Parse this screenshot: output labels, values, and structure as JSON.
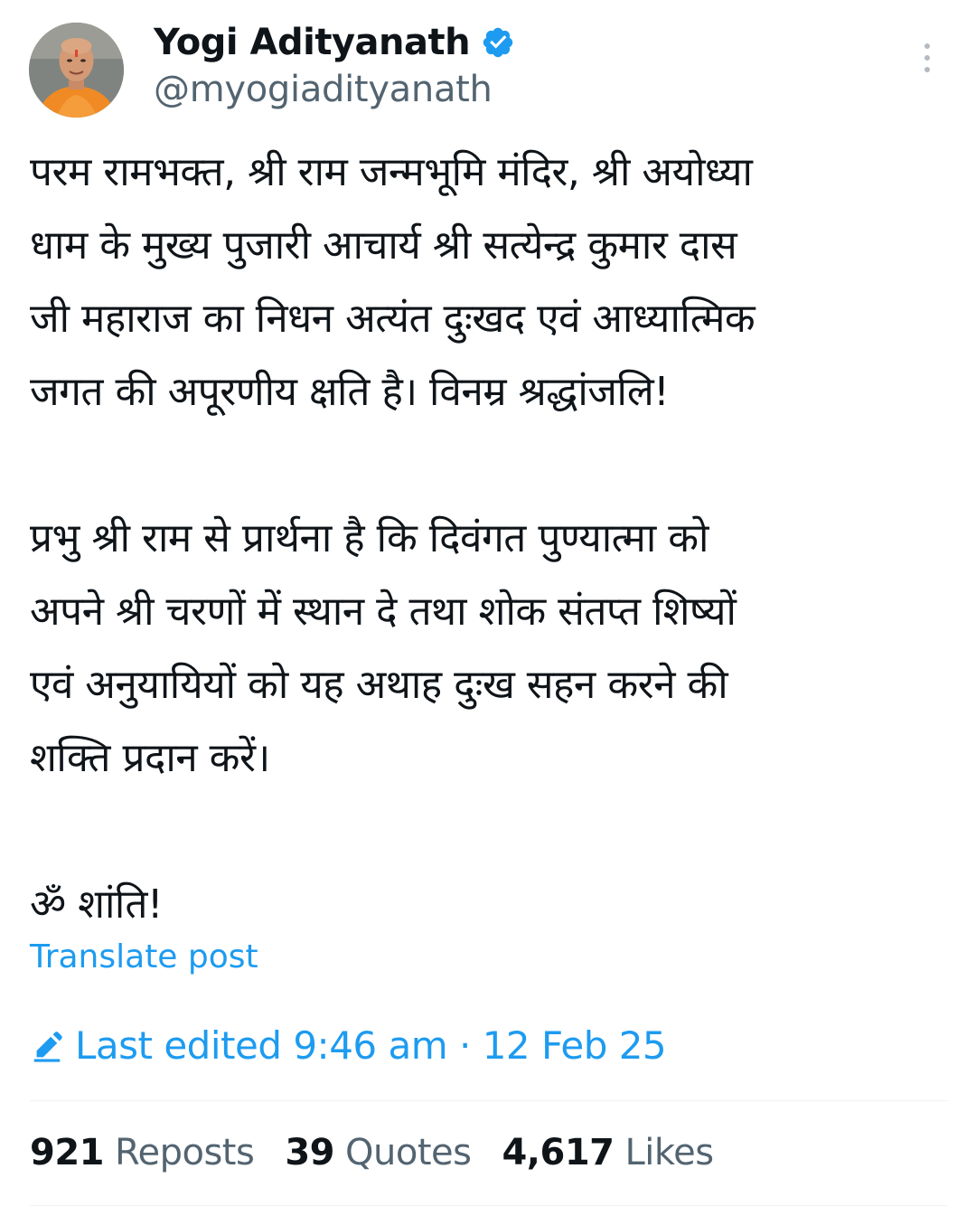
{
  "author": {
    "display_name": "Yogi Adityanath",
    "handle": "@myogiadityanath",
    "verified": true,
    "avatar_icon": "profile-photo"
  },
  "tweet": {
    "paragraphs": [
      [
        "परम रामभक्त, श्री राम जन्मभूमि मंदिर, श्री अयोध्या",
        "धाम के मुख्य पुजारी आचार्य श्री सत्येन्द्र कुमार दास",
        "जी महाराज का निधन अत्यंत दुःखद एवं आध्यात्मिक",
        "जगत की अपूरणीय क्षति है। विनम्र श्रद्धांजलि!"
      ],
      [
        "प्रभु श्री राम से प्रार्थना है कि दिवंगत पुण्यात्मा को",
        "अपने श्री चरणों में स्थान दे तथा शोक संतप्त शिष्यों",
        "एवं अनुयायियों को यह अथाह दुःख सहन करने की",
        "शक्ति प्रदान करें।"
      ],
      [
        "ॐ शांति!"
      ]
    ],
    "translate_label": "Translate post",
    "edited_text": "Last edited 9:46 am · 12 Feb 25"
  },
  "stats": {
    "reposts": {
      "count": "921",
      "label": "Reposts"
    },
    "quotes": {
      "count": "39",
      "label": "Quotes"
    },
    "likes": {
      "count": "4,617",
      "label": "Likes"
    }
  },
  "colors": {
    "link": "#1d9bf0",
    "secondary_text": "#536471",
    "primary_text": "#0f1419",
    "divider": "#eff3f4"
  }
}
